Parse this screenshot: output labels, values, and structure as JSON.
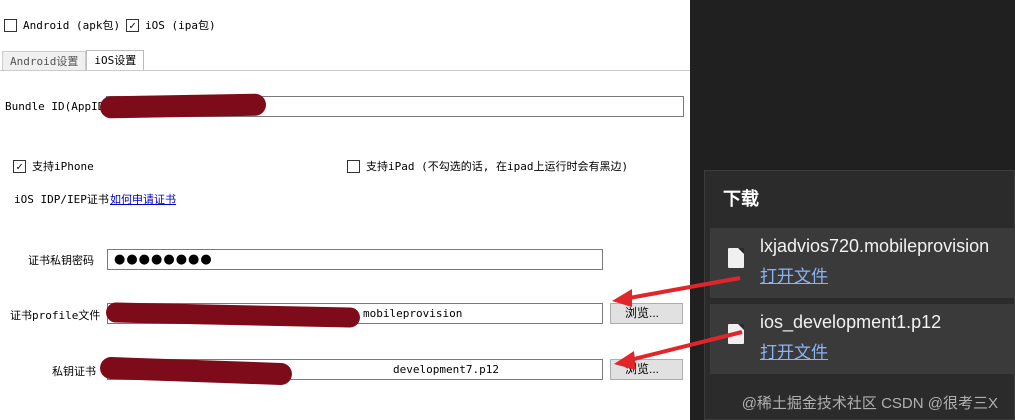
{
  "platforms": {
    "android": {
      "label": "Android (apk包)",
      "checked": false
    },
    "ios": {
      "label": "iOS (ipa包)",
      "checked": true
    }
  },
  "tabs": [
    {
      "label": "Android设置",
      "active": false
    },
    {
      "label": "iOS设置",
      "active": true
    }
  ],
  "ios_settings": {
    "bundle_id_label": "Bundle ID(AppID)",
    "bundle_id_value": "",
    "support_iphone": {
      "label": "支持iPhone",
      "checked": true
    },
    "support_ipad": {
      "label": "支持iPad (不勾选的话, 在ipad上运行时会有黑边)",
      "checked": false
    },
    "idp_label": "iOS IDP/IEP证书",
    "apply_link": "如何申请证书",
    "cert_password_label": "证书私钥密码",
    "cert_password_value": "●●●●●●●●",
    "profile_label": "证书profile文件",
    "profile_value": "mobileprovision",
    "private_cert_label": "私钥证书",
    "private_cert_value": "development7.p12",
    "browse_label": "浏览..."
  },
  "downloads": {
    "title": "下载",
    "items": [
      {
        "name": "lxjadvios720.mobileprovision",
        "action": "打开文件"
      },
      {
        "name": "ios_development1.p12",
        "action": "打开文件"
      }
    ],
    "watermark": "@稀土掘金技术社区 CSDN @很考三X"
  },
  "colors": {
    "arrow": "#e0262a",
    "redaction": "#7e0b1a",
    "link": "#0000cc"
  }
}
